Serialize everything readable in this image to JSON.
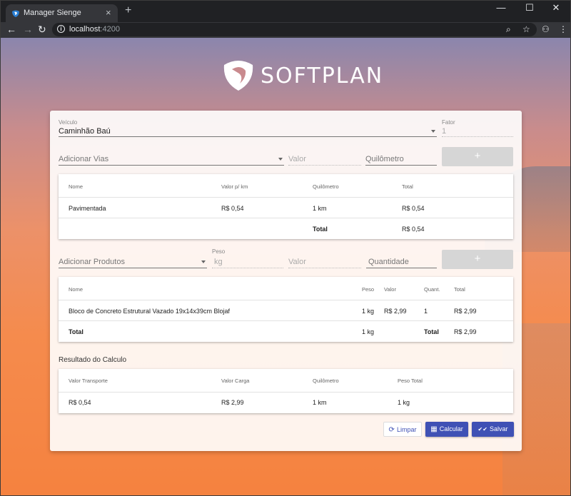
{
  "browser": {
    "tab_title": "Manager Sienge",
    "tab_close": "×",
    "new_tab": "+",
    "win_min": "—",
    "win_max": "☐",
    "win_close": "✕",
    "back": "←",
    "forward": "→",
    "reload": "↻",
    "info": "i",
    "url_host": "localhost",
    "url_port": ":4200",
    "zoom_icon": "⌕",
    "star_icon": "☆",
    "ext_icon": "⚇",
    "menu_icon": "⋮"
  },
  "brand": {
    "logo_text": "SOFTPLAN"
  },
  "vehicle": {
    "label": "Veículo",
    "value": "Caminhão Baú",
    "fator_label": "Fator",
    "fator_value": "1"
  },
  "vias_form": {
    "select_placeholder": "Adicionar Vias",
    "valor_placeholder": "Valor",
    "km_placeholder": "Quilômetro",
    "add_label": "+"
  },
  "vias_table": {
    "headers": [
      "Nome",
      "Valor p/ km",
      "Quilômetro",
      "Total"
    ],
    "rows": [
      {
        "nome": "Pavimentada",
        "valor": "R$ 0,54",
        "km": "1 km",
        "total": "R$ 0,54"
      }
    ],
    "footer": {
      "label": "Total",
      "total": "R$ 0,54"
    }
  },
  "produtos_form": {
    "select_placeholder": "Adicionar Produtos",
    "peso_label": "Peso",
    "peso_placeholder": "kg",
    "valor_placeholder": "Valor",
    "quantidade_placeholder": "Quantidade",
    "add_label": "+"
  },
  "produtos_table": {
    "headers": [
      "Nome",
      "Peso",
      "Valor",
      "Quant.",
      "Total"
    ],
    "rows": [
      {
        "nome": "Bloco de Concreto Estrutural Vazado 19x14x39cm Blojaf",
        "peso": "1 kg",
        "valor": "R$ 2,99",
        "quant": "1",
        "total": "R$ 2,99"
      }
    ],
    "footer": {
      "label": "Total",
      "peso": "1 kg",
      "quant_label": "Total",
      "total": "R$ 2,99"
    }
  },
  "resultado": {
    "title": "Resultado do Calculo",
    "headers": [
      "Valor Transporte",
      "Valor Carga",
      "Quilômetro",
      "Peso Total"
    ],
    "values": [
      "R$ 0,54",
      "R$ 2,99",
      "1 km",
      "1 kg"
    ]
  },
  "actions": {
    "limpar": "Limpar",
    "limpar_icon": "⟳",
    "calcular": "Calcular",
    "calcular_icon": "▦",
    "salvar": "Salvar",
    "salvar_icon": "✔✔"
  },
  "colors": {
    "primary": "#3f51b5",
    "disabled_button": "#d6d6d6"
  }
}
